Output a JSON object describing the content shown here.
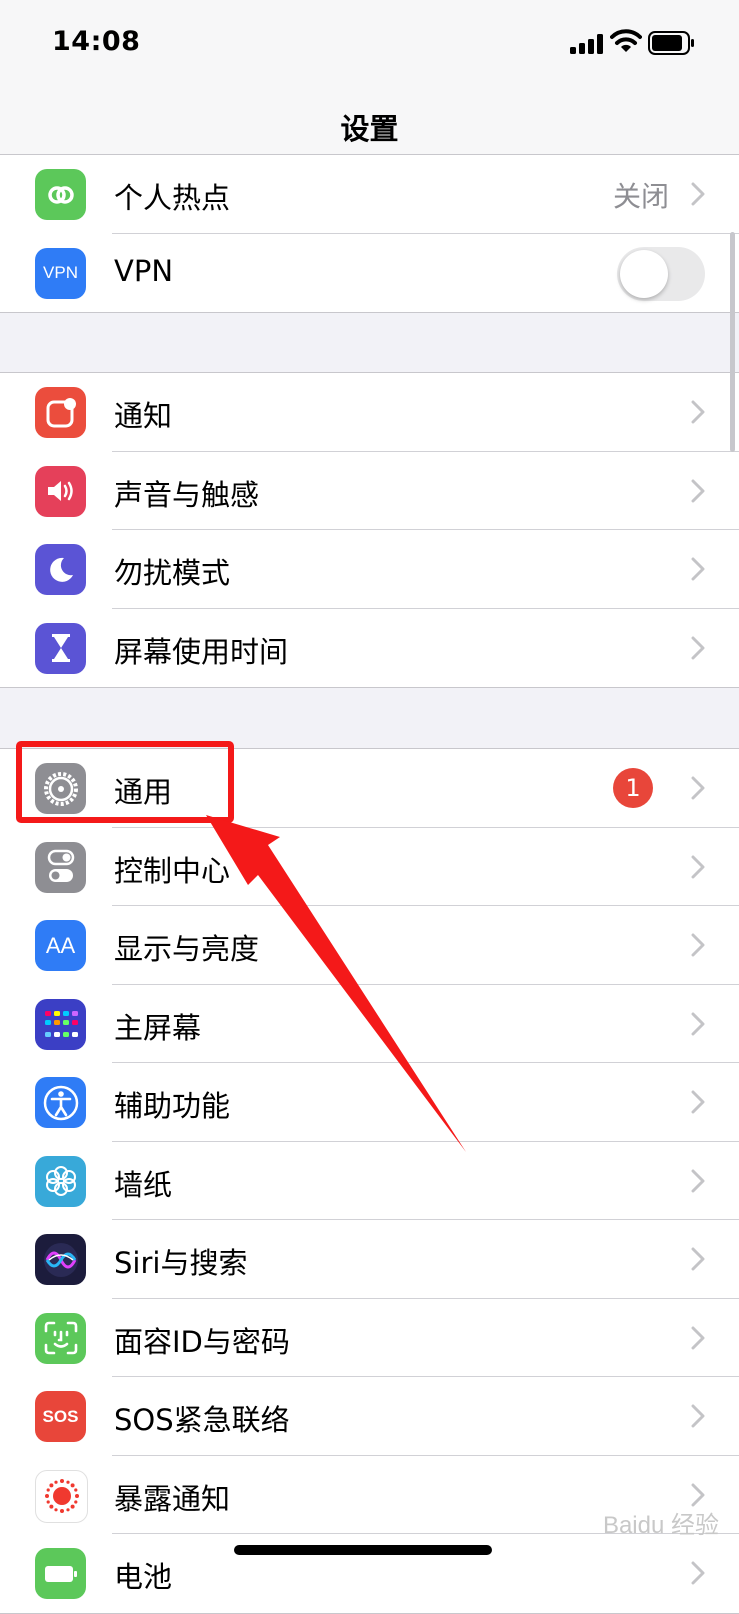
{
  "status_bar": {
    "time": "14:08"
  },
  "nav": {
    "title": "设置"
  },
  "group1": [
    {
      "label": "个人热点",
      "detail": "关闭",
      "icon": "personal-hotspot-icon",
      "color": "#5cc85a"
    },
    {
      "label": "VPN",
      "icon": "vpn-icon",
      "icon_text": "VPN",
      "color": "#2f7cf6",
      "toggle_on": false
    }
  ],
  "group2": [
    {
      "label": "通知",
      "icon": "notifications-icon",
      "color": "#eb4d3d"
    },
    {
      "label": "声音与触感",
      "icon": "sounds-icon",
      "color": "#e5405a"
    },
    {
      "label": "勿扰模式",
      "icon": "moon-icon",
      "color": "#5b54d5"
    },
    {
      "label": "屏幕使用时间",
      "icon": "hourglass-icon",
      "color": "#5b54d5"
    }
  ],
  "group3": [
    {
      "label": "通用",
      "icon": "gear-icon",
      "color": "#8e8e93",
      "badge": "1"
    },
    {
      "label": "控制中心",
      "icon": "control-center-icon",
      "color": "#8e8e93"
    },
    {
      "label": "显示与亮度",
      "icon": "display-icon",
      "icon_text": "AA",
      "color": "#2f7cf6"
    },
    {
      "label": "主屏幕",
      "icon": "home-screen-icon",
      "color": "#3b3fc5"
    },
    {
      "label": "辅助功能",
      "icon": "accessibility-icon",
      "color": "#2f7cf6"
    },
    {
      "label": "墙纸",
      "icon": "wallpaper-icon",
      "color": "#38a9d9"
    },
    {
      "label": "Siri与搜索",
      "icon": "siri-icon",
      "color": "#1c1c3c"
    },
    {
      "label": "面容ID与密码",
      "icon": "face-id-icon",
      "color": "#5cc85a"
    },
    {
      "label": "SOS紧急联络",
      "icon": "sos-icon",
      "icon_text": "SOS",
      "color": "#e8463a"
    },
    {
      "label": "暴露通知",
      "icon": "exposure-icon",
      "color": "#ffffff"
    },
    {
      "label": "电池",
      "icon": "battery-icon",
      "color": "#5cc85a"
    }
  ],
  "watermark": "Baidu 经验"
}
